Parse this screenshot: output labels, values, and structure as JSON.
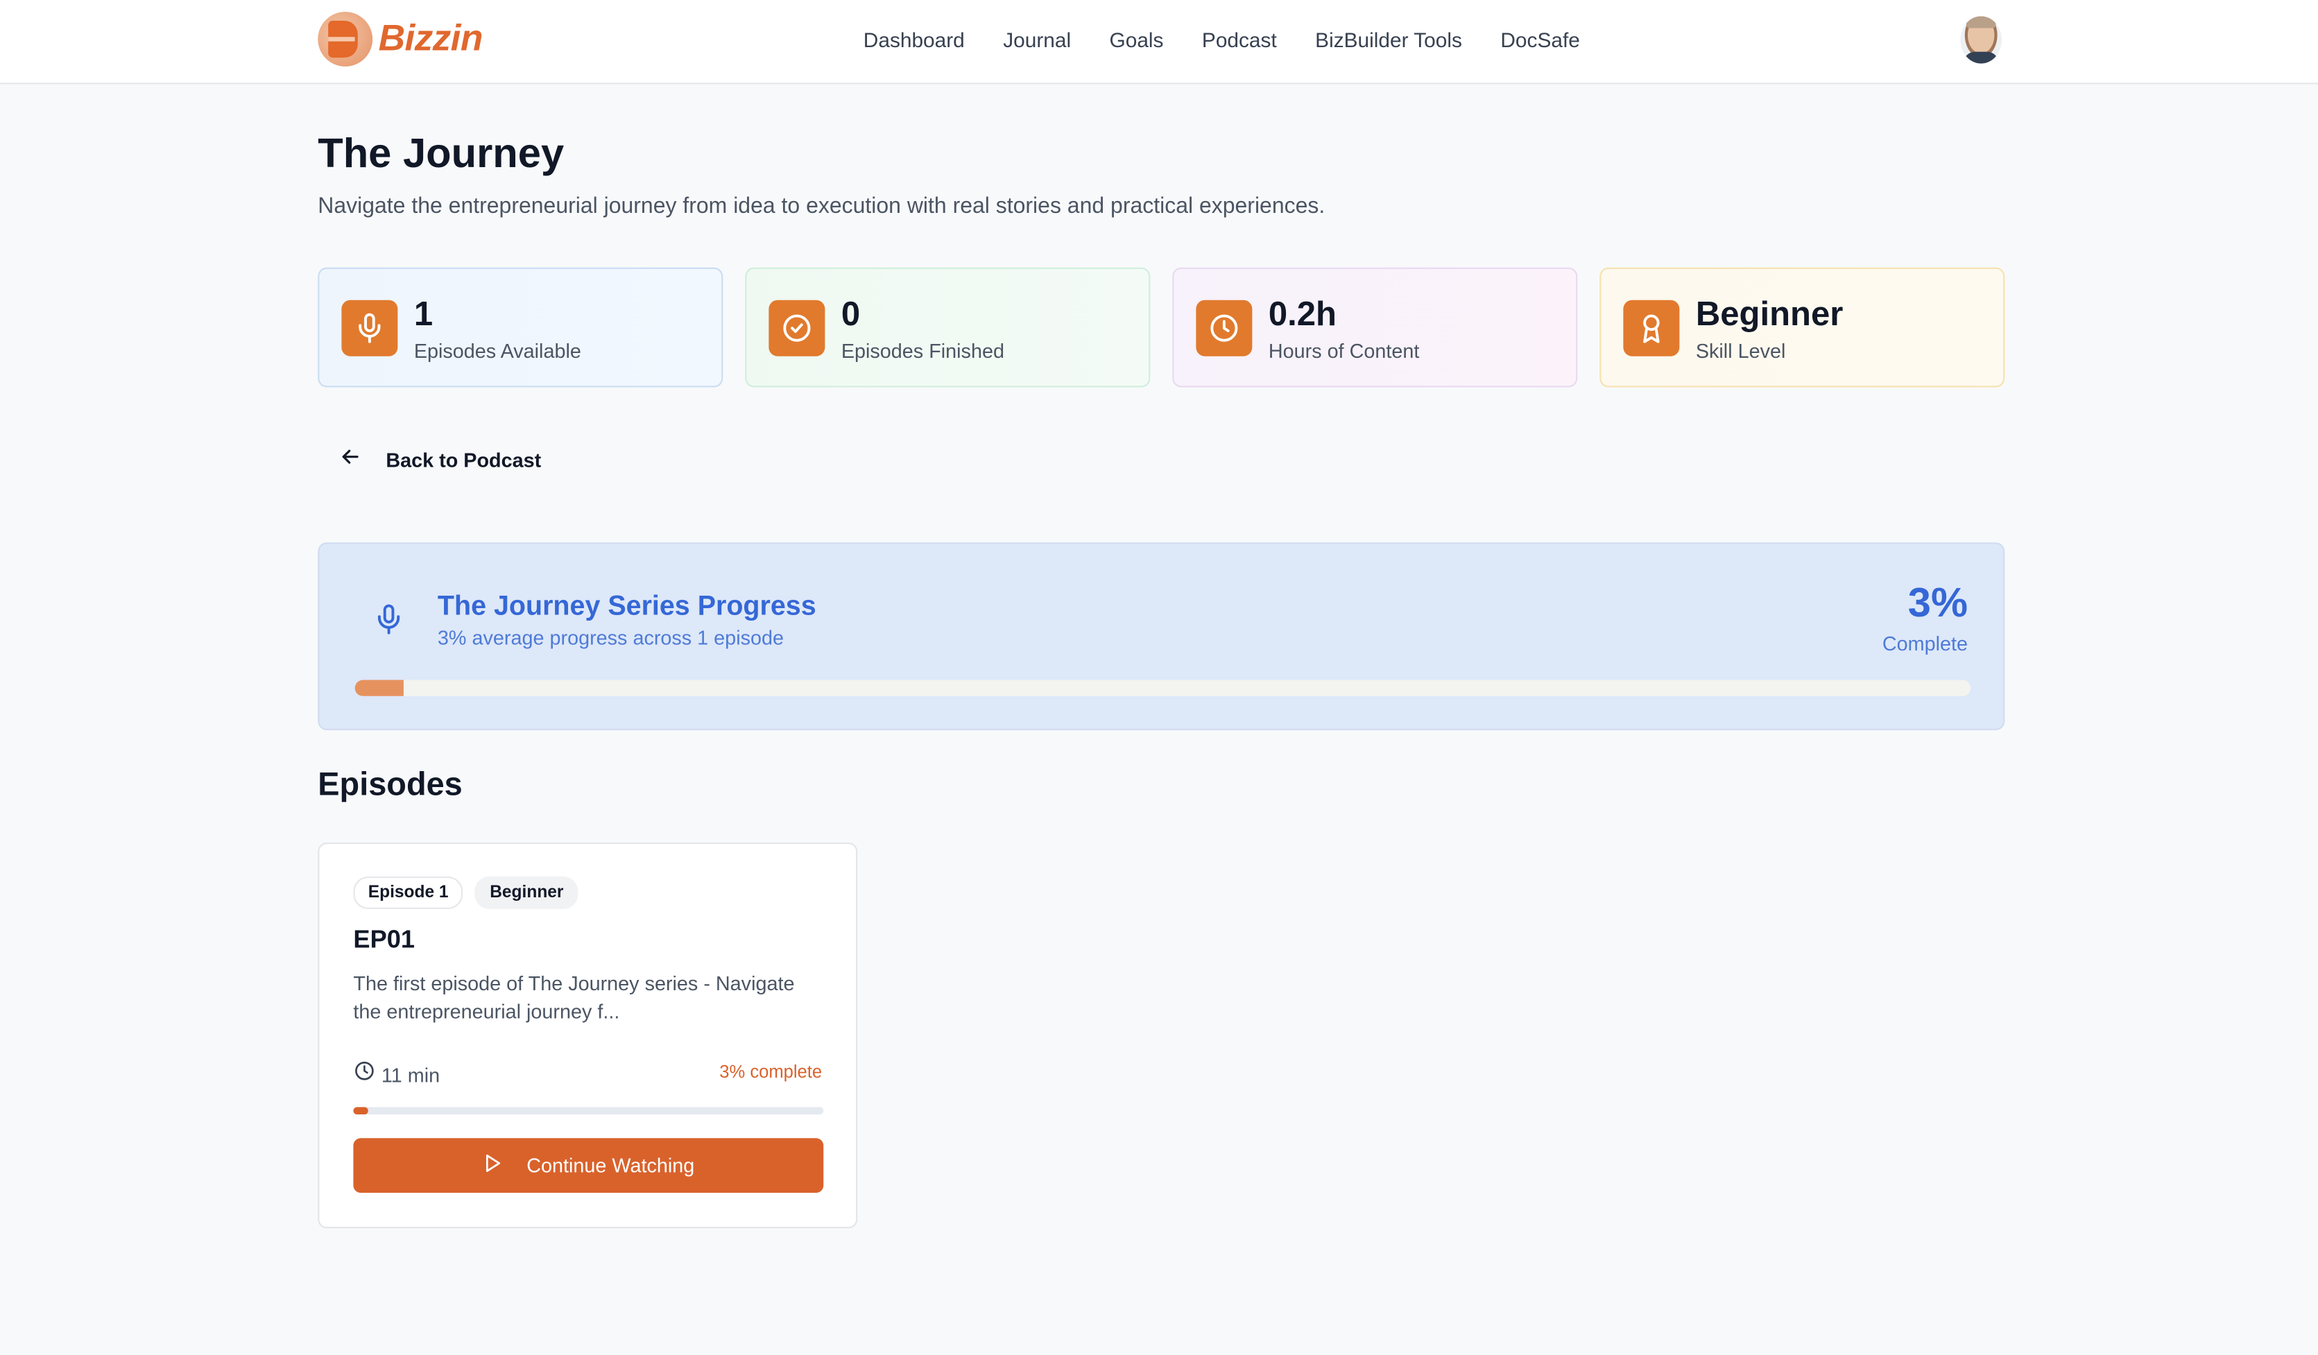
{
  "header": {
    "brand": "Bizzin",
    "nav": [
      "Dashboard",
      "Journal",
      "Goals",
      "Podcast",
      "BizBuilder Tools",
      "DocSafe"
    ]
  },
  "page": {
    "title": "The Journey",
    "subtitle": "Navigate the entrepreneurial journey from idea to execution with real stories and practical experiences."
  },
  "stats": [
    {
      "value": "1",
      "label": "Episodes Available",
      "icon": "microphone-icon"
    },
    {
      "value": "0",
      "label": "Episodes Finished",
      "icon": "check-circle-icon"
    },
    {
      "value": "0.2h",
      "label": "Hours of Content",
      "icon": "clock-icon"
    },
    {
      "value": "Beginner",
      "label": "Skill Level",
      "icon": "award-icon"
    }
  ],
  "back": {
    "label": "Back to Podcast"
  },
  "series_progress": {
    "title": "The Journey Series Progress",
    "subtitle": "3% average progress across 1 episode",
    "percent_label": "3%",
    "complete_label": "Complete",
    "progress": 3
  },
  "episodes": {
    "title": "Episodes",
    "items": [
      {
        "badge_episode": "Episode 1",
        "badge_level": "Beginner",
        "title": "EP01",
        "description": "The first episode of The Journey series - Navigate the entrepreneurial journey f...",
        "duration": "11 min",
        "complete_label": "3% complete",
        "progress": 3,
        "button_label": "Continue Watching"
      }
    ]
  },
  "colors": {
    "accent": "#d9622b",
    "brand": "#e0682e",
    "series_blue": "#3567d6",
    "stat_icon_bg": "#e17a2d"
  }
}
